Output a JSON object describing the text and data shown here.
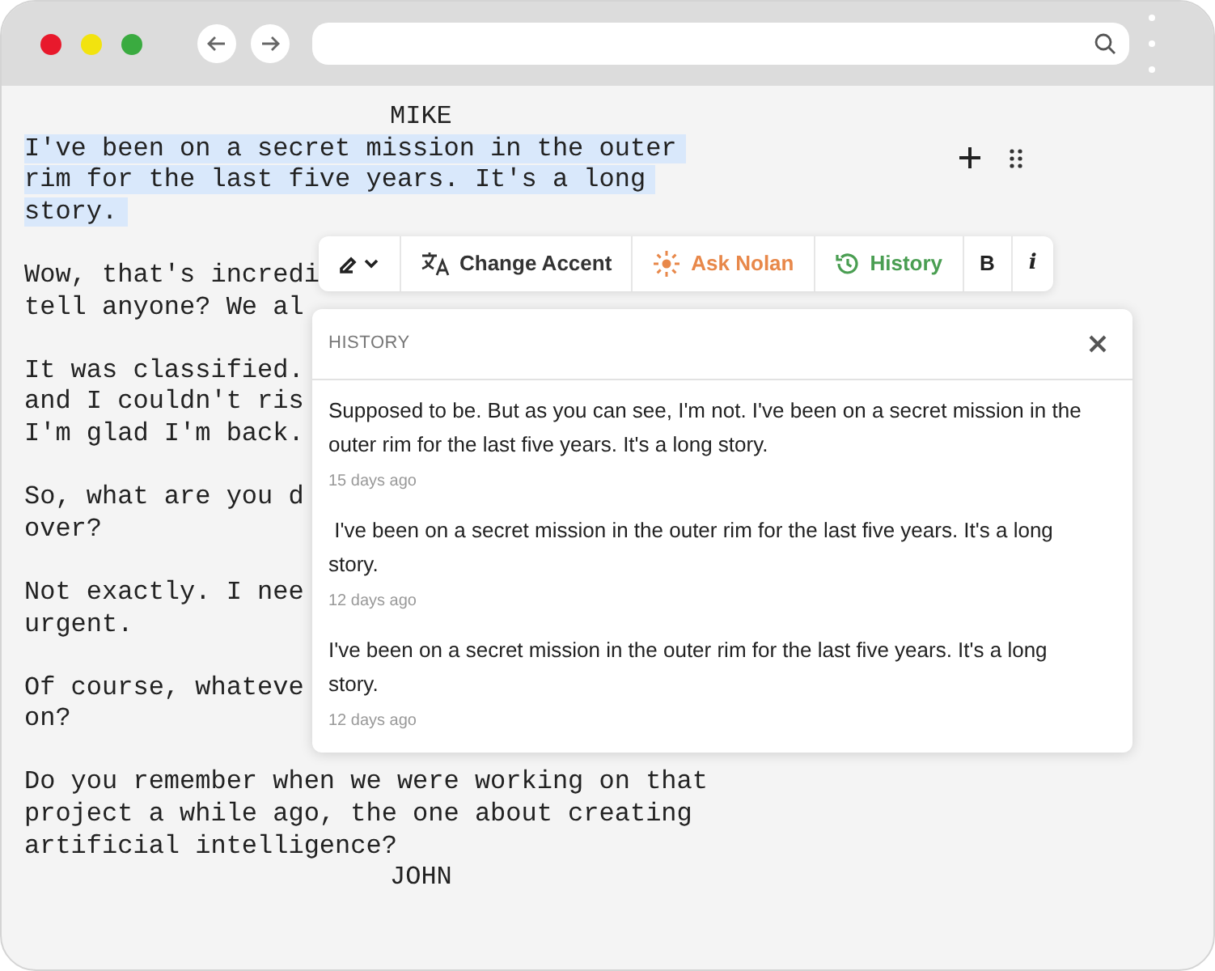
{
  "script": [
    {
      "kind": "character",
      "text": "MIKE"
    },
    {
      "kind": "dialogue",
      "selected": true,
      "lines": [
        "I've been on a secret mission in the outer",
        "rim for the last five years. It's a long",
        "story."
      ]
    },
    {
      "kind": "gap"
    },
    {
      "kind": "dialogue",
      "selected": false,
      "lines": [
        "Wow, that's incredi",
        "tell anyone? We al"
      ]
    },
    {
      "kind": "gap"
    },
    {
      "kind": "dialogue",
      "selected": false,
      "lines": [
        "It was classified.",
        "and I couldn't ris",
        "I'm glad I'm back."
      ]
    },
    {
      "kind": "gap"
    },
    {
      "kind": "dialogue",
      "selected": false,
      "lines": [
        "So, what are you d",
        "over?"
      ]
    },
    {
      "kind": "gap"
    },
    {
      "kind": "dialogue",
      "selected": false,
      "lines": [
        "Not exactly. I nee",
        "urgent."
      ]
    },
    {
      "kind": "gap"
    },
    {
      "kind": "dialogue",
      "selected": false,
      "lines": [
        "Of course, whateve",
        "on?"
      ]
    },
    {
      "kind": "gap"
    },
    {
      "kind": "dialogue",
      "selected": false,
      "lines": [
        "Do you remember when we were working on that",
        "project a while ago, the one about creating",
        "artificial intelligence?"
      ]
    },
    {
      "kind": "character",
      "text": "JOHN"
    }
  ],
  "toolbar": [
    {
      "kind": "pen",
      "color": "#222222"
    },
    {
      "kind": "translate",
      "label": "Change Accent",
      "color": "#333333"
    },
    {
      "kind": "sparkle",
      "label": "Ask Nolan",
      "color": "#e8884a"
    },
    {
      "kind": "history",
      "label": "History",
      "color": "#4a9e52"
    },
    {
      "kind": "bold",
      "label": "B",
      "color": "#222222"
    },
    {
      "kind": "italic",
      "label": "i",
      "color": "#222222"
    }
  ],
  "history": {
    "title": "HISTORY",
    "entries": [
      {
        "text": "Supposed to be. But as you can see, I'm not. I've been on a secret mission in the outer rim for the last five years. It's a long story.",
        "time": "15 days ago"
      },
      {
        "text": " I've been on a secret mission in the outer rim for the last five years. It's a long story.",
        "time": "12 days ago"
      },
      {
        "text": "I've been on a secret mission in the outer rim for the last five years. It's a long story.",
        "time": "12 days ago"
      }
    ]
  }
}
